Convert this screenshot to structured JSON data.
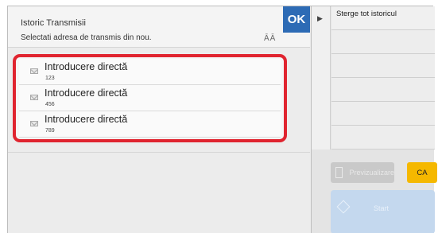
{
  "header": {
    "title": "Istoric Transmisii",
    "subtitle": "Selectati adresa de transmis din nou.",
    "ok_label": "OK",
    "sort_icon": "ĀĀ"
  },
  "list": {
    "items": [
      {
        "name": "Introducere directă",
        "number": "123"
      },
      {
        "name": "Introducere directă",
        "number": "456"
      },
      {
        "name": "Introducere directă",
        "number": "789"
      }
    ]
  },
  "right": {
    "arrow": "▶",
    "menu": [
      "Sterge tot istoricul"
    ],
    "preview_label": "Previzualizare",
    "ca_label": "CA",
    "start_label": "Start"
  },
  "colors": {
    "ok_blue": "#2d6bb5",
    "highlight_red": "#e0242f",
    "ca_yellow": "#f5b800",
    "start_blue": "#c4d8ee"
  }
}
